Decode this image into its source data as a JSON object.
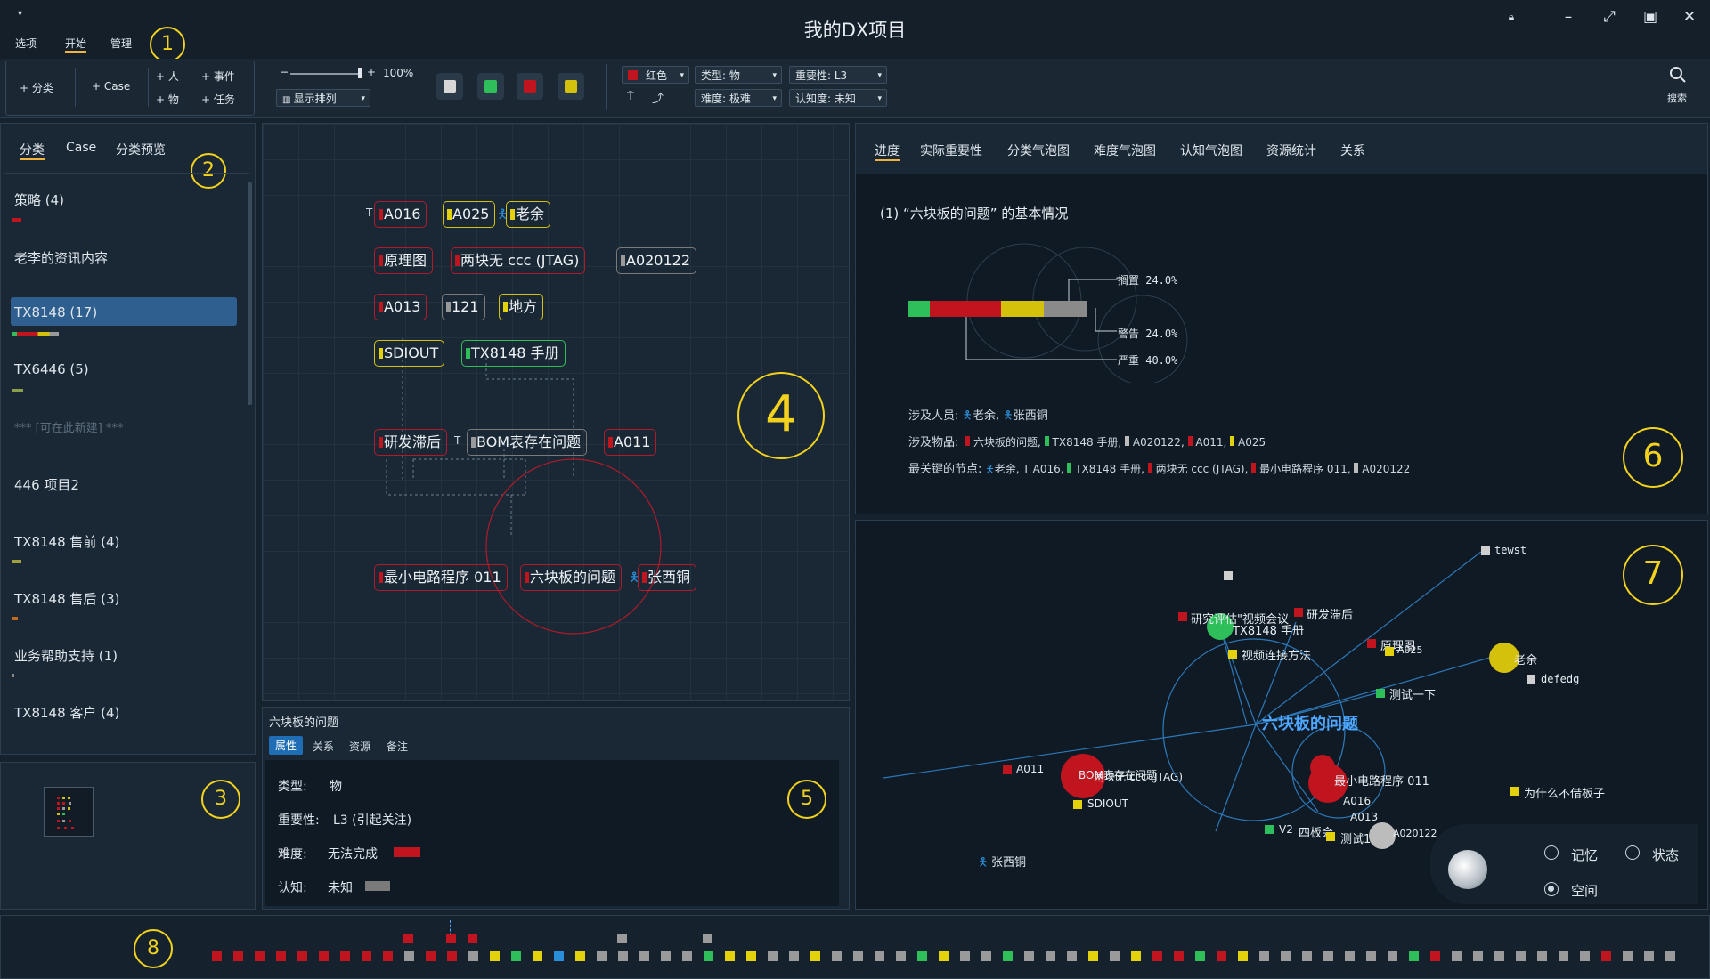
{
  "window": {
    "title": "我的DX项目"
  },
  "menu": {
    "items": [
      "选项",
      "开始",
      "管理"
    ]
  },
  "ribbon": {
    "add_category": "+ 分类",
    "add_case": "+ Case",
    "add_person": "+ 人",
    "add_event": "+ 事件",
    "add_object": "+ 物",
    "add_task": "+ 任务",
    "zoom": "100%",
    "zoom_minus": "−",
    "zoom_plus": "+",
    "display_sort": "显示排列",
    "color_combo": "红色",
    "type_combo": "类型: 物",
    "importance_combo": "重要性: L3",
    "difficulty_combo": "难度: 极难",
    "cognition_combo": "认知度: 未知",
    "search_label": "搜索"
  },
  "callouts": [
    "1",
    "2",
    "3",
    "4",
    "5",
    "6",
    "7",
    "8"
  ],
  "category_panel": {
    "tabs": [
      "分类",
      "Case",
      "分类预览"
    ],
    "items": [
      {
        "label": "策略 (4)"
      },
      {
        "label": "老李的资讯内容"
      },
      {
        "label": "TX8148 (17)"
      },
      {
        "label": "TX6446 (5)"
      },
      {
        "label": "*** [可在此新建] ***"
      },
      {
        "label": "446 项目2"
      },
      {
        "label": "TX8148 售前 (4)"
      },
      {
        "label": "TX8148 售后 (3)"
      },
      {
        "label": "业务帮助支持 (1)"
      },
      {
        "label": "TX8148 客户 (4)"
      }
    ]
  },
  "canvas": {
    "nodes": [
      {
        "label": "A016",
        "prefix": "T"
      },
      {
        "label": "A025"
      },
      {
        "label": "老余"
      },
      {
        "label": "原理图"
      },
      {
        "label": "两块无 ccc (JTAG)"
      },
      {
        "label": "A020122"
      },
      {
        "label": "A013"
      },
      {
        "label": "121"
      },
      {
        "label": "地方"
      },
      {
        "label": "SDIOUT"
      },
      {
        "label": "TX8148 手册"
      },
      {
        "label": "研发滞后"
      },
      {
        "label": "BOM表存在问题",
        "prefix": "T"
      },
      {
        "label": "A011"
      },
      {
        "label": "最小电路程序 011"
      },
      {
        "label": "六块板的问题"
      },
      {
        "label": "张西铜"
      }
    ]
  },
  "attributes": {
    "title": "六块板的问题",
    "tabs": [
      "属性",
      "关系",
      "资源",
      "备注"
    ],
    "rows": [
      {
        "key": "类型:",
        "value": "物"
      },
      {
        "key": "重要性:",
        "value": "L3 (引起关注)"
      },
      {
        "key": "难度:",
        "value": "无法完成"
      },
      {
        "key": "认知:",
        "value": "未知"
      }
    ]
  },
  "stats": {
    "tabs": [
      "进度",
      "实际重要性",
      "分类气泡图",
      "难度气泡图",
      "认知气泡图",
      "资源统计",
      "关系"
    ],
    "heading": "(1) “六块板的问题” 的基本情况",
    "bar_legend": [
      {
        "label": "搁置 24.0%"
      },
      {
        "label": "警告 24.0%"
      },
      {
        "label": "严重 40.0%"
      }
    ],
    "bar_segments": [
      {
        "color": "#2fbf5a",
        "fraction": 0.12
      },
      {
        "color": "#c0141e",
        "fraction": 0.4
      },
      {
        "color": "#d4c10c",
        "fraction": 0.24
      },
      {
        "color": "#8a8a8a",
        "fraction": 0.24
      }
    ],
    "people_label": "涉及人员:",
    "people": [
      "老余,",
      "张西铜"
    ],
    "objects_label": "涉及物品:",
    "objects": [
      "六块板的问题,",
      "TX8148 手册,",
      "A020122,",
      "A011,",
      "A025"
    ],
    "key_nodes_label": "最关键的节点:",
    "key_nodes": [
      "老余,",
      "A016,",
      "TX8148 手册,",
      "两块无 ccc (JTAG),",
      "最小电路程序 011,",
      "A020122"
    ]
  },
  "graph": {
    "center_label": "六块板的问题",
    "labels": [
      "tewst",
      "研发滞后",
      "研究评估\"视频会议",
      "TX8148 手册",
      "视频连接方法",
      "原理图",
      "A025",
      "老余",
      "defedg",
      "测试一下",
      "A011",
      "BOM表存在问题",
      "两块无 ccc (JTAG)",
      "SDIOUT",
      "最小电路程序 011",
      "A016",
      "A013",
      "为什么不借板子",
      "V2",
      "四板会",
      "测试1",
      "A020122",
      "张西铜"
    ],
    "modes": [
      {
        "label": "记忆",
        "checked": false
      },
      {
        "label": "状态",
        "checked": false
      },
      {
        "label": "空间",
        "checked": true
      }
    ]
  },
  "colors": {
    "red": "#c0141e",
    "yellow": "#e3d10c",
    "green": "#2fbf5a",
    "gray": "#9a9a9a",
    "blue": "#2a8fd8",
    "accent": "#f2d21c"
  }
}
